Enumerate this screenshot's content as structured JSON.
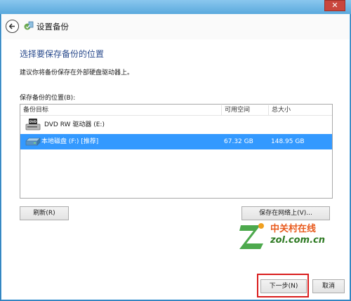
{
  "window": {
    "close_glyph": "✕"
  },
  "header": {
    "title": "设置备份"
  },
  "main": {
    "heading": "选择要保存备份的位置",
    "description": "建议你将备份保存在外部硬盘驱动器上。",
    "location_label": "保存备份的位置(B):"
  },
  "list": {
    "columns": [
      "备份目标",
      "可用空间",
      "总大小"
    ],
    "rows": [
      {
        "name": "DVD RW 驱动器 (E:)",
        "free": "",
        "total": "",
        "icon": "dvd-drive-icon",
        "selected": false
      },
      {
        "name": "本地磁盘 (F:) [推荐]",
        "free": "67.32 GB",
        "total": "148.95 GB",
        "icon": "hard-disk-icon",
        "selected": true
      }
    ]
  },
  "buttons": {
    "refresh": "刷新(R)",
    "save_network": "保存在网络上(V)...",
    "next": "下一步(N)",
    "cancel": "取消"
  },
  "watermark": {
    "line1": "中关村在线",
    "line2": "zol.com.cn"
  },
  "colors": {
    "heading": "#2a4b8d",
    "selection": "#3399ff",
    "highlight": "#d91c1c"
  }
}
